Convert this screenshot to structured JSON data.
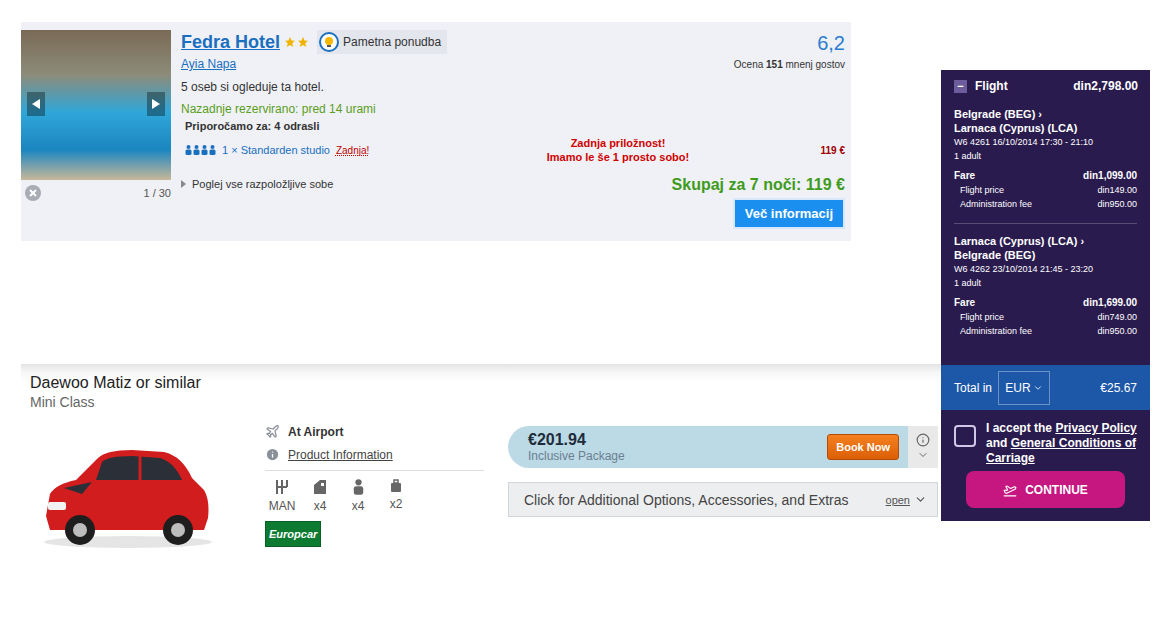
{
  "hotel": {
    "name": "Fedra Hotel",
    "stars": 2,
    "badge": "Pametna ponudba",
    "location": "Ayia Napa",
    "score": "6,2",
    "reviews": {
      "prefix": "Ocena",
      "count": "151",
      "suffix": "mnenj gostov"
    },
    "viewers": "5 oseb si ogleduje ta hotel.",
    "last_booked": "Nazadnje rezervirano: pred 14 urami",
    "recommended": "Priporočamo za: 4 odrasli",
    "room": {
      "guests": 4,
      "name": "1 × Standarden studio",
      "tag": "Zadnja!",
      "warning": [
        "Zadnja priložnost!",
        "Imamo le še 1 prosto sobo!"
      ],
      "price": "119 €"
    },
    "gallery": {
      "counter": "1 / 30"
    },
    "all_rooms_link": "Poglej vse razpoložljive sobe",
    "total": "Skupaj za 7 noči: 119 €",
    "button": "Več informacij"
  },
  "car": {
    "title": "Daewoo Matiz or similar",
    "class": "Mini Class",
    "pickup": "At Airport",
    "info_link": "Product Information",
    "specs": [
      {
        "kind": "transmission",
        "label": "MAN"
      },
      {
        "kind": "doors",
        "label": "x4"
      },
      {
        "kind": "seats",
        "label": "x4"
      },
      {
        "kind": "bags",
        "label": "x2"
      }
    ],
    "supplier": "Europcar",
    "price": "€201.94",
    "package": "Inclusive Package",
    "book": "Book Now",
    "extras": "Click for Additional Options, Accessories, and Extras",
    "extras_toggle": "open"
  },
  "flight": {
    "toggle": "−",
    "expanded": true,
    "title": "Flight",
    "amount": "din2,798.00",
    "legs": [
      {
        "from": "Belgrade (BEG)",
        "arrow": "›",
        "to": "Larnaca (Cyprus) (LCA)",
        "details": "W6 4261 16/10/2014 17:30 - 21:10",
        "passengers": "1 adult",
        "fare_label": "Fare",
        "fare": "din1,099.00",
        "items": [
          {
            "label": "Flight price",
            "value": "din149.00"
          },
          {
            "label": "Administration fee",
            "value": "din950.00"
          }
        ]
      },
      {
        "from": "Larnaca (Cyprus) (LCA)",
        "arrow": "›",
        "to": "Belgrade (BEG)",
        "details": "W6 4262 23/10/2014 21:45 - 23:20",
        "passengers": "1 adult",
        "fare_label": "Fare",
        "fare": "din1,699.00",
        "items": [
          {
            "label": "Flight price",
            "value": "din749.00"
          },
          {
            "label": "Administration fee",
            "value": "din950.00"
          }
        ]
      }
    ],
    "total_label": "Total in",
    "currency": "EUR",
    "total": "€25.67",
    "accept": {
      "checked": false,
      "prefix": "I accept the",
      "link1": "Privacy Policy",
      "middle": "and",
      "link2": "General Conditions of Carriage"
    },
    "button": "CONTINUE"
  }
}
